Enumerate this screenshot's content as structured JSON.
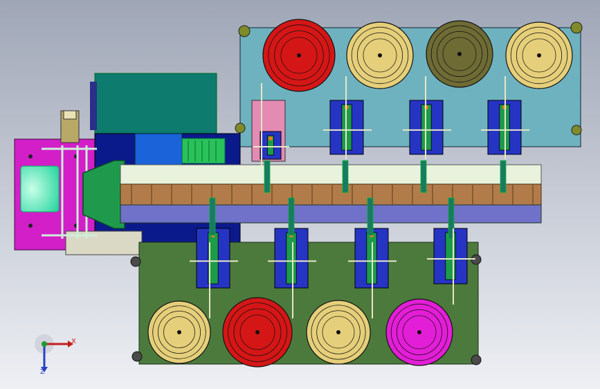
{
  "viewport": {
    "background_top": "#9fa6b6",
    "background_bottom": "#eef0f4",
    "triad": {
      "x_label": "X",
      "z_label": "Z",
      "x_color": "#c21d1d",
      "y_color": "#1e9b2a",
      "z_color": "#2b3fc2"
    }
  },
  "colors": {
    "upper_plate": "#6fb2bf",
    "lower_plate": "#4c7a3d",
    "magenta_block": "#d21fc8",
    "teal_box": "#0d7b6d",
    "navy_frame": "#0b1a8a",
    "blue_motor": "#1a63d8",
    "green_motor": "#29c25a",
    "conveyor_light": "#e8f2dc",
    "conveyor_wood": "#b27c4a",
    "conveyor_purple": "#6f72c8",
    "bowl_cream": "#e6cf7a",
    "bowl_red": "#d51616",
    "bowl_olive": "#6e6b35",
    "bowl_magenta": "#e31ed7",
    "feeder_blue": "#2634c4",
    "pink_plate": "#e38bb3"
  },
  "top_bowls": [
    "red",
    "cream",
    "olive",
    "cream"
  ],
  "bottom_bowls": [
    "cream",
    "red",
    "cream",
    "magenta"
  ]
}
